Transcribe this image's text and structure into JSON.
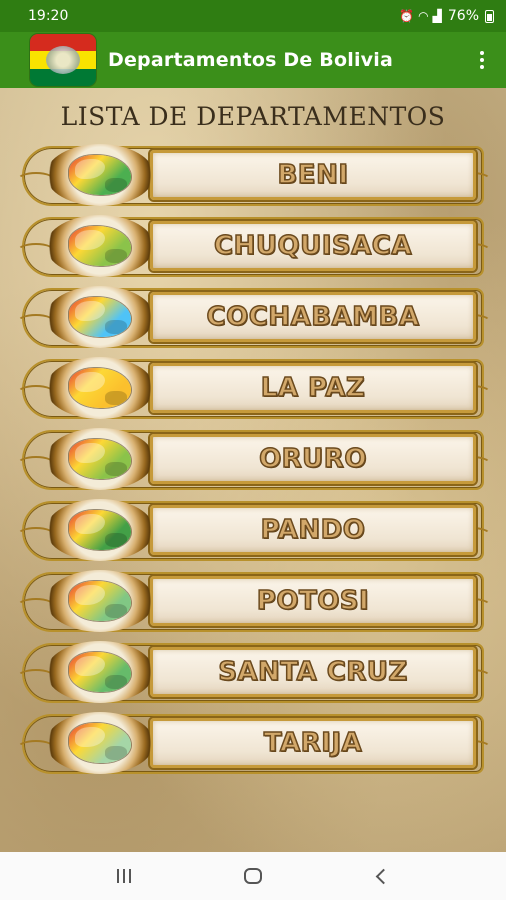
{
  "status_bar": {
    "time": "19:20",
    "battery_percent": "76%",
    "icons": [
      "alarm-icon",
      "wifi-icon",
      "signal-icon",
      "battery-icon"
    ]
  },
  "app_bar": {
    "title": "Departamentos De Bolivia",
    "menu_icon": "more-vert-icon"
  },
  "list": {
    "title": "LISTA DE DEPARTAMENTOS",
    "items": [
      {
        "label": "BENI",
        "map_color": "#4caf50"
      },
      {
        "label": "CHUQUISACA",
        "map_color": "#8bc34a"
      },
      {
        "label": "COCHABAMBA",
        "map_color": "#4fc3f7"
      },
      {
        "label": "LA PAZ",
        "map_color": "#fbc02d"
      },
      {
        "label": "ORURO",
        "map_color": "#8bc34a"
      },
      {
        "label": "PANDO",
        "map_color": "#43a047"
      },
      {
        "label": "POTOSI",
        "map_color": "#81c784"
      },
      {
        "label": "SANTA CRUZ",
        "map_color": "#66bb6a"
      },
      {
        "label": "TARIJA",
        "map_color": "#a5d6a7"
      }
    ]
  },
  "colors": {
    "app_bar": "#3b8f1a",
    "status_bar": "#2f7d12",
    "frame_gold": "#b8912c",
    "label_fill": "#d2a86a"
  },
  "nav_bar": {
    "icons": [
      "recents-icon",
      "home-icon",
      "back-icon"
    ]
  }
}
